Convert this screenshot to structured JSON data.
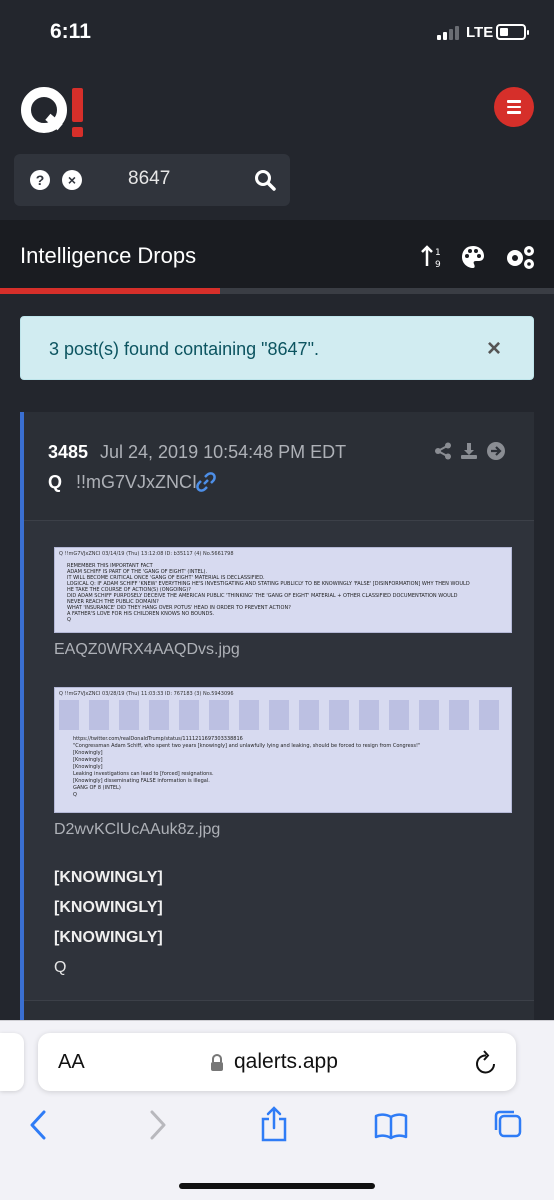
{
  "status": {
    "time": "6:11",
    "network": "LTE"
  },
  "header": {
    "logo": "Q!"
  },
  "search": {
    "query": "8647"
  },
  "nav": {
    "title": "Intelligence Drops"
  },
  "alert": {
    "message": "3 post(s) found containing \"8647\".",
    "close": "×"
  },
  "post": {
    "number": "3485",
    "date": "Jul 24, 2019 10:54:48 PM EDT",
    "author": "Q",
    "tripcode": "!!mG7VJxZNCI",
    "images": [
      {
        "filename": "EAQZ0WRX4AAQDvs.jpg",
        "header": "Q  !!mG7VJxZNCI  03/14/19 (Thu) 13:12:08  ID: b35117 (4)  No.5661798",
        "lines": [
          "REMEMBER THIS IMPORTANT FACT",
          "ADAM SCHIFF IS PART OF THE 'GANG OF EIGHT' (INTEL).",
          "IT WILL BECOME CRITICAL ONCE 'GANG OF EIGHT' MATERIAL IS DECLASSIFIED.",
          "LOGICAL Q: IF ADAM SCHIFF 'KNEW' EVERYTHING HE'S INVESTIGATING AND STATING PUBLICLY TO BE KNOWINGLY 'FALSE' [DISINFORMATION] WHY THEN WOULD",
          "HE TAKE THE COURSE OF ACTION(S) (ONGOING)?",
          "DID ADAM SCHIFF PURPOSELY DECEIVE THE AMERICAN PUBLIC 'THINKING' THE 'GANG OF EIGHT' MATERIAL + OTHER CLASSIFIED DOCUMENTATION WOULD",
          "NEVER REACH THE PUBLIC DOMAIN?",
          "WHAT 'INSURANCE' DID THEY HANG OVER POTUS' HEAD IN ORDER TO PREVENT ACTION?",
          "A FATHER'S LOVE FOR HIS CHILDREN KNOWS NO BOUNDS.",
          "Q"
        ]
      },
      {
        "filename": "D2wvKClUcAAuk8z.jpg",
        "header": "Q  !!mG7VJxZNCI  03/28/19 (Thu) 11:03:33  ID: 767183 (3)  No.5943096",
        "lines": [
          "https://twitter.com/realDonaldTrump/status/1111211697303338816",
          "\"Congressman Adam Schiff, who spent two years [knowingly] and unlawfully lying and leaking, should be forced to resign from Congress!\"",
          "[Knowingly]",
          "[Knowingly]",
          "[Knowingly]",
          "Leaking investigations can lead to [forced] resignations.",
          "[Knowingly] disseminating FALSE information is illegal.",
          "GANG OF 8 (INTEL)",
          "Q"
        ]
      }
    ],
    "body": [
      "[KNOWINGLY]",
      "[KNOWINGLY]",
      "[KNOWINGLY]",
      "Q"
    ]
  },
  "browser": {
    "aa": "AA",
    "url": "qalerts.app"
  },
  "colors": {
    "accent": "#d62f2a",
    "alert_bg": "#d1ecf1",
    "post_border": "#3a6fd1",
    "link": "#4d8fe8"
  }
}
